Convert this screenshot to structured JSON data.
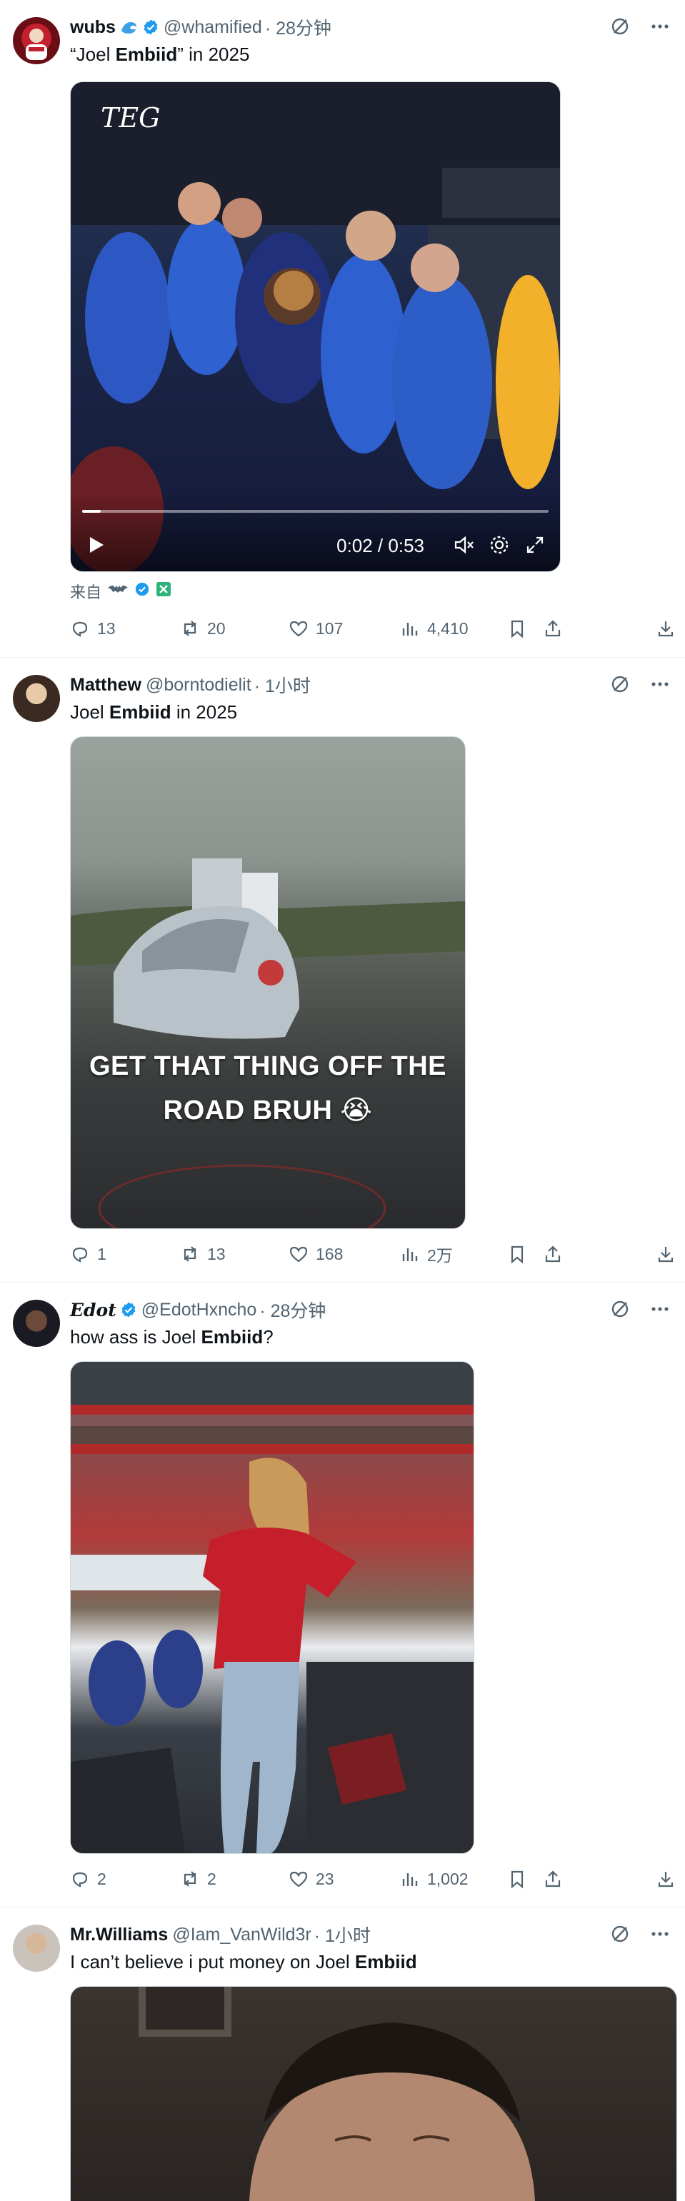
{
  "posts": [
    {
      "display_name": "wubs",
      "handle": "@whamified",
      "time": "· 28分钟",
      "text_before": "“Joel ",
      "text_bold": "Embiid",
      "text_after": "” in 2025",
      "video": {
        "overlay_text": "TEG",
        "time": "0:02 / 0:53",
        "progress_fraction": 0.04
      },
      "source_label": "来自",
      "stats": {
        "replies": "13",
        "reposts": "20",
        "likes": "107",
        "views": "4,410"
      }
    },
    {
      "display_name": "Matthew",
      "handle": "@borntodielit",
      "time": "· 1小时",
      "text_before": "Joel ",
      "text_bold": "Embiid",
      "text_after": " in 2025",
      "image_caption_line1": "GET THAT THING OFF THE",
      "image_caption_line2": "ROAD BRUH 😭",
      "stats": {
        "replies": "1",
        "reposts": "13",
        "likes": "168",
        "views": "2万"
      }
    },
    {
      "display_name": "Edot",
      "handle": "@EdotHxncho",
      "time": "· 28分钟",
      "text_before": "how ass is Joel ",
      "text_bold": "Embiid",
      "text_after": "?",
      "stats": {
        "replies": "2",
        "reposts": "2",
        "likes": "23",
        "views": "1,002"
      }
    },
    {
      "display_name": "Mr.Williams",
      "handle": "@Iam_VanWild3r",
      "time": "· 1小时",
      "text_before": "I can’t believe i put money on Joel ",
      "text_bold": "Embiid",
      "text_after": ""
    }
  ],
  "colors": {
    "verified": "#1d9bf0",
    "text": "#0f1419",
    "secondary": "#536471",
    "divider": "#eff3f4"
  }
}
